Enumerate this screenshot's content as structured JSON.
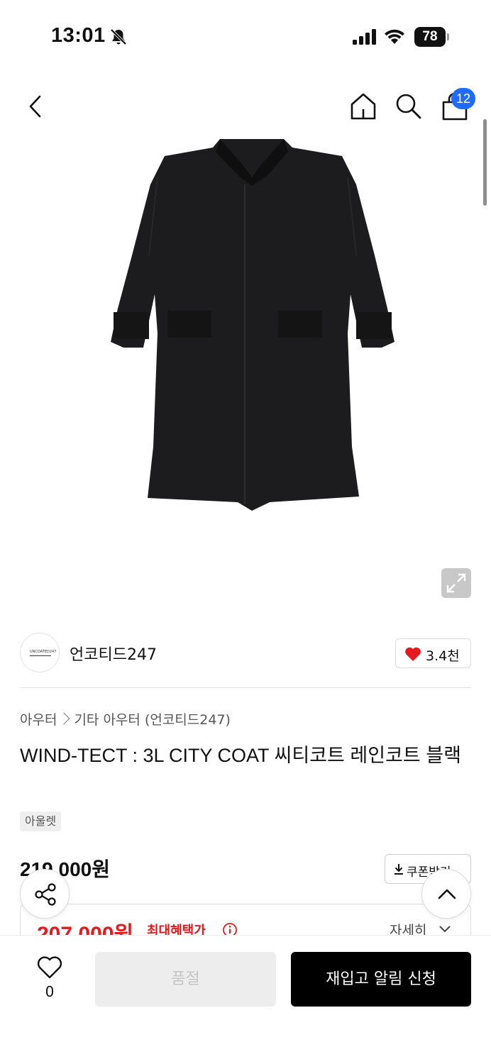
{
  "status_bar": {
    "time": "13:01",
    "battery": "78"
  },
  "header": {
    "cart_count": "12"
  },
  "brand": {
    "name": "언코티드247",
    "logo_text": "UNCOATED247",
    "likes": "3.4천"
  },
  "product": {
    "breadcrumb": [
      "아우터",
      "기타 아우터 (언코티드247)"
    ],
    "title": "WIND-TECT : 3L CITY COAT 씨티코트 레인코트 블랙",
    "tag": "아울렛",
    "original_price": "219,000원",
    "coupon_label": "쿠폰받기",
    "sale_price": "207,000원",
    "max_benefit_label": "최대혜택가",
    "detail_label": "자세히"
  },
  "bottom_bar": {
    "wish_count": "0",
    "soldout_label": "품절",
    "restock_label": "재입고 알림 신청"
  },
  "colors": {
    "accent_red": "#e8191c",
    "badge_blue": "#1e6bff",
    "primary_black": "#000000"
  }
}
